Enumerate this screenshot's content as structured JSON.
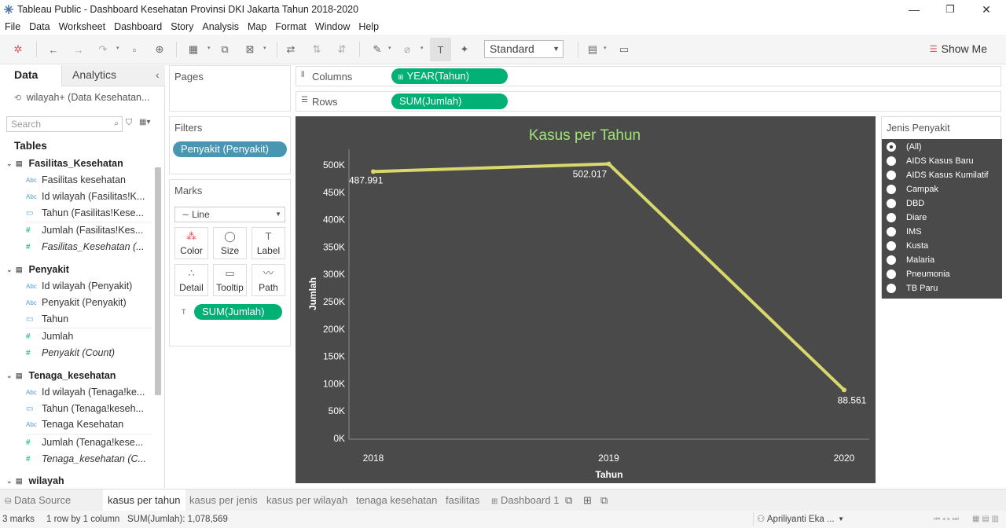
{
  "window": {
    "title": "Tableau Public - Dashboard Kesehatan Provinsi DKI Jakarta Tahun 2018-2020",
    "minimize": "—",
    "maximize": "❐",
    "close": "✕"
  },
  "menu": [
    "File",
    "Data",
    "Worksheet",
    "Dashboard",
    "Story",
    "Analysis",
    "Map",
    "Format",
    "Window",
    "Help"
  ],
  "toolbar": {
    "fit_value": "Standard",
    "show_me": "Show Me"
  },
  "left_panel": {
    "tab_data": "Data",
    "tab_analytics": "Analytics",
    "collapse": "‹",
    "datasource": "wilayah+ (Data Kesehatan...",
    "search_placeholder": "Search",
    "tables_heading": "Tables",
    "groups": [
      {
        "name": "Fasilitas_Kesehatan",
        "fields": [
          {
            "icon": "Abc",
            "label": "Fasilitas kesehatan"
          },
          {
            "icon": "Abc",
            "label": "Id wilayah (Fasilitas!K..."
          },
          {
            "icon": "date",
            "label": "Tahun (Fasilitas!Kese..."
          },
          {
            "icon": "#",
            "label": "Jumlah (Fasilitas!Kes..."
          },
          {
            "icon": "#",
            "label": "Fasilitas_Kesehatan (..."
          }
        ]
      },
      {
        "name": "Penyakit",
        "fields": [
          {
            "icon": "Abc",
            "label": "Id wilayah (Penyakit)"
          },
          {
            "icon": "Abc",
            "label": "Penyakit (Penyakit)"
          },
          {
            "icon": "date",
            "label": "Tahun"
          },
          {
            "icon": "#",
            "label": "Jumlah"
          },
          {
            "icon": "#",
            "label": "Penyakit (Count)"
          }
        ]
      },
      {
        "name": "Tenaga_kesehatan",
        "fields": [
          {
            "icon": "Abc",
            "label": "Id wilayah (Tenaga!ke..."
          },
          {
            "icon": "date",
            "label": "Tahun (Tenaga!keseh..."
          },
          {
            "icon": "Abc",
            "label": "Tenaga Kesehatan"
          },
          {
            "icon": "#",
            "label": "Jumlah (Tenaga!kese..."
          },
          {
            "icon": "#",
            "label": "Tenaga_kesehatan (C..."
          }
        ]
      },
      {
        "name": "wilayah",
        "fields": []
      }
    ]
  },
  "cards": {
    "pages": "Pages",
    "filters": "Filters",
    "filter_pill": "Penyakit (Penyakit)",
    "marks": "Marks",
    "mark_type": "Line",
    "mark_buttons": [
      "Color",
      "Size",
      "Label",
      "Detail",
      "Tooltip",
      "Path"
    ],
    "marks_pill": "SUM(Jumlah)",
    "columns_label": "Columns",
    "columns_pill": "YEAR(Tahun)",
    "rows_label": "Rows",
    "rows_pill": "SUM(Jumlah)"
  },
  "chart_data": {
    "type": "line",
    "title": "Kasus per Tahun",
    "xlabel": "Tahun",
    "ylabel": "Jumlah",
    "x": [
      "2018",
      "2019",
      "2020"
    ],
    "values": [
      487991,
      502017,
      88561
    ],
    "data_labels": [
      "487.991",
      "502.017",
      "88.561"
    ],
    "y_ticks": [
      "0K",
      "50K",
      "100K",
      "150K",
      "200K",
      "250K",
      "300K",
      "350K",
      "400K",
      "450K",
      "500K"
    ],
    "ylim": [
      0,
      500000
    ],
    "line_color": "#d8d96a",
    "title_color": "#a3e07a",
    "background": "#4a4a4a",
    "grid": false
  },
  "legend": {
    "title": "Jenis Penyakit",
    "items": [
      "(All)",
      "AIDS Kasus Baru",
      "AIDS Kasus Kumilatif",
      "Campak",
      "DBD",
      "Diare",
      "IMS",
      "Kusta",
      "Malaria",
      "Pneumonia",
      "TB Paru"
    ],
    "selected": "(All)"
  },
  "sheet_tabs": {
    "data_source": "Data Source",
    "tabs": [
      "kasus per tahun",
      "kasus per jenis",
      "kasus per wilayah",
      "tenaga kesehatan",
      "fasilitas",
      "Dashboard 1"
    ],
    "active": "kasus per tahun"
  },
  "status": {
    "marks": "3 marks",
    "rows_cols": "1 row by 1 column",
    "sum": "SUM(Jumlah): 1,078,569",
    "user": "Apriliyanti Eka ..."
  }
}
